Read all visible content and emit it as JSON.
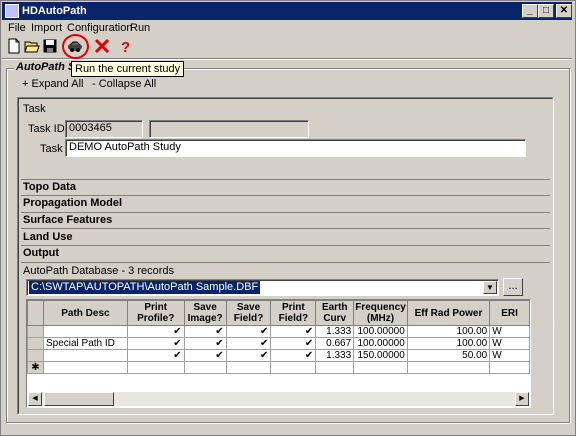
{
  "app": {
    "title": "HDAutoPath"
  },
  "window_buttons": {
    "minimize": "_",
    "maximize": "□",
    "close": "✕"
  },
  "menu": [
    "File",
    "Import",
    "Configuration",
    "Run"
  ],
  "toolbar": {
    "icons": [
      "new-icon",
      "open-icon",
      "save-icon",
      "run-icon",
      "delete-icon",
      "help-icon"
    ],
    "tooltip": "Run the current study",
    "highlight_color": "#e00000"
  },
  "group": {
    "title": "AutoPath St"
  },
  "tree": {
    "expand": "+ Expand All",
    "collapse": "- Collapse All"
  },
  "task": {
    "section": "Task",
    "id_label": "Task ID:",
    "id_value": "0003465",
    "id_extra": "",
    "name_label": "Task",
    "name_value": "DEMO AutoPath Study"
  },
  "sections": [
    "Topo Data",
    "Propagation Model",
    "Surface Features",
    "Land Use",
    "Output"
  ],
  "database": {
    "label": "AutoPath Database - 3 records",
    "path": "C:\\SWTAP\\AUTOPATH\\AutoPath Sample.DBF",
    "browse": "...",
    "columns": [
      "Path Desc",
      "Print Profile?",
      "Save Image?",
      "Save Field?",
      "Print Field?",
      "Earth Curv",
      "Frequency (MHz)",
      "Eff Rad Power",
      "ERI"
    ],
    "rows": [
      {
        "desc": "",
        "print_profile": "✔",
        "save_image": "✔",
        "save_field": "✔",
        "print_field": "✔",
        "earth": "1.333",
        "freq": "100.00000",
        "erp": "100.00",
        "eri": "W"
      },
      {
        "desc": "Special Path ID",
        "print_profile": "✔",
        "save_image": "✔",
        "save_field": "✔",
        "print_field": "✔",
        "earth": "0.667",
        "freq": "100.00000",
        "erp": "100.00",
        "eri": "W"
      },
      {
        "desc": "",
        "print_profile": "✔",
        "save_image": "✔",
        "save_field": "✔",
        "print_field": "✔",
        "earth": "1.333",
        "freq": "150.00000",
        "erp": "50.00",
        "eri": "W"
      }
    ],
    "new_row_marker": "✱"
  },
  "colors": {
    "titlebar": "#0a246a",
    "selection": "#0a246a",
    "face": "#d4d0c8"
  }
}
